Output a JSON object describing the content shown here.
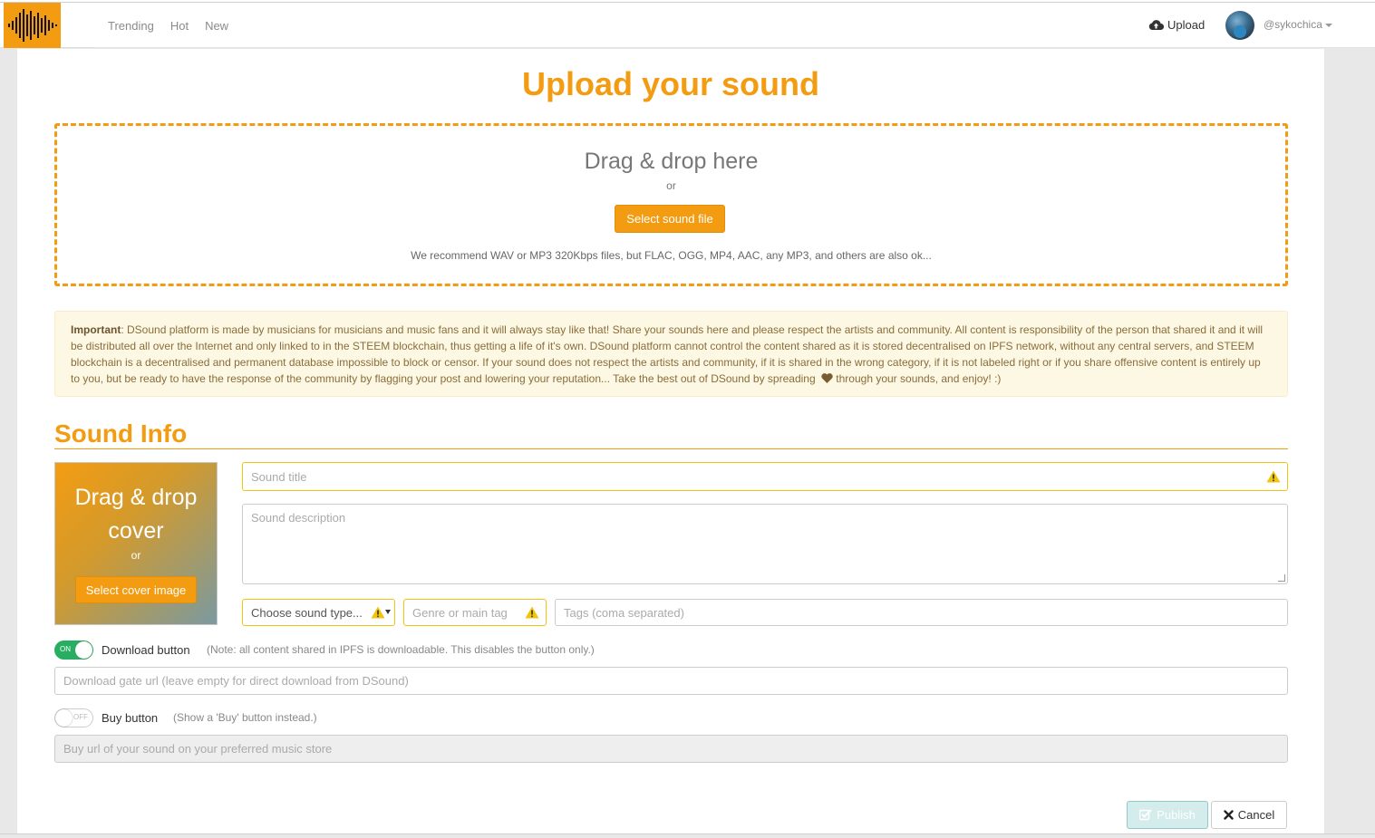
{
  "nav": {
    "logo": "dsound-logo-icon",
    "links": [
      "Trending",
      "Hot",
      "New"
    ],
    "upload_label": "Upload",
    "username": "@sykochica"
  },
  "page": {
    "title": "Upload your sound"
  },
  "dropzone": {
    "title": "Drag & drop here",
    "or": "or",
    "button": "Select sound file",
    "hint": "We recommend WAV or MP3 320Kbps files, but FLAC, OGG, MP4, AAC, any MP3, and others are also ok..."
  },
  "notice": {
    "label": "Important",
    "text_before_heart": ": DSound platform is made by musicians for musicians and music fans and it will always stay like that! Share your sounds here and please respect the artists and community. All content is responsibility of the person that shared it and it will be distributed all over the Internet and only linked to in the STEEM blockchain, thus getting a life of it's own. DSound platform cannot control the content shared as it is stored decentralised on IPFS network, without any central servers, and STEEM blockchain is a decentralised and permanent database impossible to block or censor. If your sound does not respect the artists and community, if it is shared in the wrong category, if it is not labeled right or if you share offensive content is entirely up to you, but be ready to have the response of the community by flagging your post and lowering your reputation... Take the best out of DSound by spreading",
    "text_after_heart": " through your sounds, and enjoy! :)"
  },
  "sound_info": {
    "section_title": "Sound Info",
    "cover": {
      "title": "Drag & drop cover",
      "or": "or",
      "button": "Select cover image"
    },
    "title_placeholder": "Sound title",
    "description_placeholder": "Sound description",
    "type_select": "Choose sound type...",
    "genre_placeholder": "Genre or main tag",
    "tags_placeholder": "Tags (coma separated)"
  },
  "options": {
    "download": {
      "toggle_state": "ON",
      "label": "Download button",
      "note": "(Note: all content shared in IPFS is downloadable. This disables the button only.)",
      "url_placeholder": "Download gate url (leave empty for direct download from DSound)"
    },
    "buy": {
      "toggle_state": "OFF",
      "label": "Buy button",
      "note": "(Show a 'Buy' button instead.)",
      "url_placeholder": "Buy url of your sound on your preferred music store"
    }
  },
  "actions": {
    "publish": "Publish",
    "cancel": "Cancel"
  },
  "colors": {
    "accent": "#f39c12",
    "toggle_on": "#27ae60",
    "warning": "#f1c40f"
  }
}
